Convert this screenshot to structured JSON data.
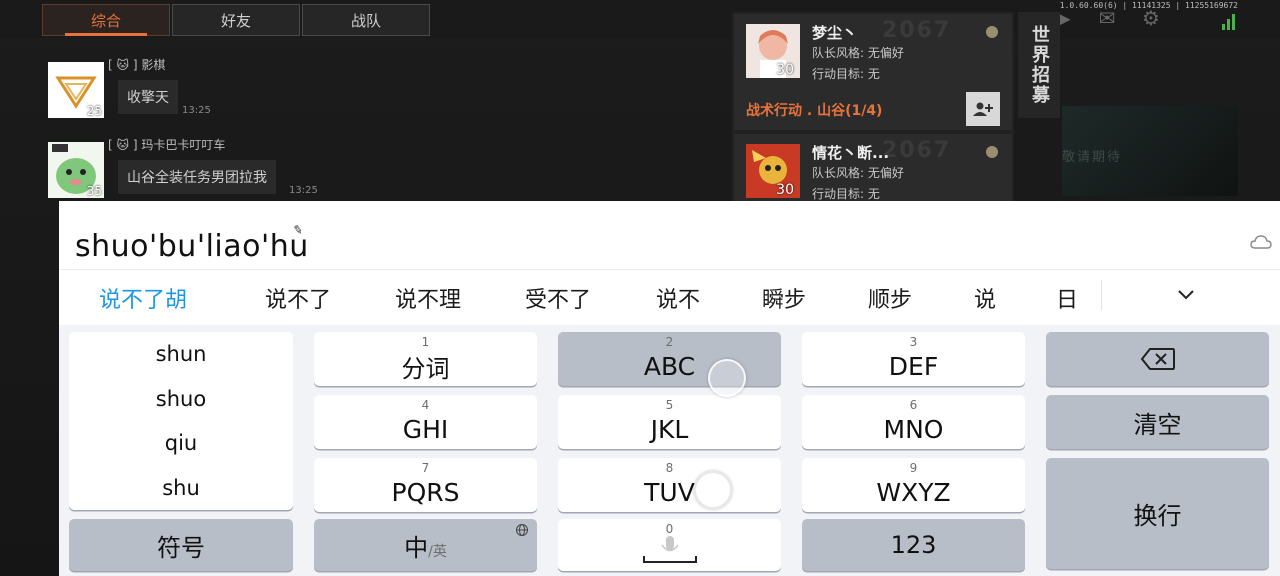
{
  "game": {
    "tabs": [
      "综合",
      "好友",
      "战队"
    ],
    "active_tab": 0,
    "version": "1.0.60.60(6) | 11141325 | 11255169672",
    "messages": [
      {
        "sender": "[ 🐱 ] 影棋",
        "level": "25",
        "text": "收擎天",
        "time": "13:25"
      },
      {
        "sender": "[ 🐱 ] 玛卡巴卡叮叮车",
        "level": "35",
        "text": "山谷全装任务男团拉我",
        "time": "13:25"
      }
    ],
    "recruits": [
      {
        "name": "梦尘丶",
        "level": "30",
        "style": "队长风格: 无偏好",
        "goal": "行动目标: 无",
        "mission": "战术行动 . 山谷(1/4)",
        "watermark": "2067"
      },
      {
        "name": "情花丶断...",
        "level": "30",
        "style": "队长风格: 无偏好",
        "goal": "行动目标: 无",
        "watermark": "2067"
      }
    ],
    "world_recruit": "世界招募",
    "bg_caption": "敬请期待"
  },
  "ime": {
    "pinyin": "shuo'bu'liao'hu",
    "candidates": [
      "说不了胡",
      "说不了",
      "说不理",
      "受不了",
      "说不",
      "瞬步",
      "顺步",
      "说",
      "日"
    ],
    "syllables": [
      "shun",
      "shuo",
      "qiu",
      "shu"
    ],
    "keys": [
      {
        "num": "1",
        "label": "分词"
      },
      {
        "num": "2",
        "label": "ABC"
      },
      {
        "num": "3",
        "label": "DEF"
      },
      {
        "num": "4",
        "label": "GHI"
      },
      {
        "num": "5",
        "label": "JKL"
      },
      {
        "num": "6",
        "label": "MNO"
      },
      {
        "num": "7",
        "label": "PQRS"
      },
      {
        "num": "8",
        "label": "TUV"
      },
      {
        "num": "9",
        "label": "WXYZ"
      }
    ],
    "clear": "清空",
    "enter": "换行",
    "symbols": "符号",
    "lang_main": "中",
    "lang_alt": "/英",
    "space_num": "0",
    "num_mode": "123",
    "colors": {
      "candidate_active": "#1e96e8",
      "key_light": "#ffffff",
      "key_dark": "#b7bec8",
      "accent_orange": "#e8733a"
    }
  }
}
